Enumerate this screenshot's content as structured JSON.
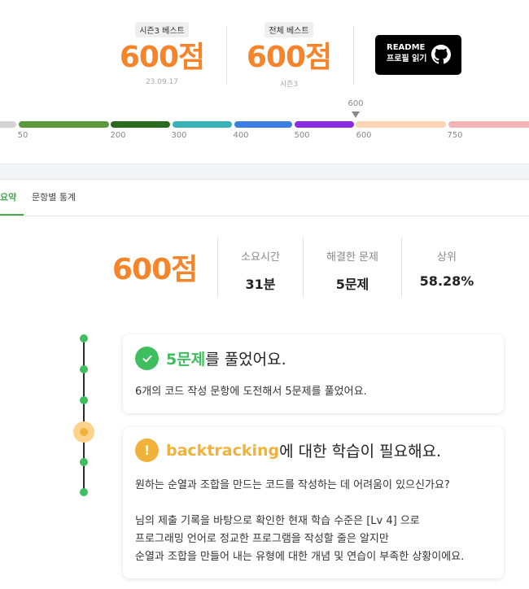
{
  "best_scores": {
    "season": {
      "tag": "시즌3 베스트",
      "score": "600점",
      "sub": "23.09.17"
    },
    "overall": {
      "tag": "전체 베스트",
      "score": "600점",
      "sub": "시즌3"
    }
  },
  "readme_button": {
    "line1": "README",
    "line2": "프로필 읽기",
    "icon": "github-icon"
  },
  "rating_bar": {
    "current_marker": "600",
    "ticks": [
      "50",
      "200",
      "300",
      "400",
      "500",
      "600",
      "750"
    ],
    "segment_colors": [
      "#d3d3d3",
      "#5a9a3c",
      "#2c6b1f",
      "#38b2b6",
      "#3d7fe0",
      "#8a2be2",
      "#f9d5b3",
      "#f6b3b5"
    ]
  },
  "tabs": {
    "summary": "요약",
    "stats": "문항별 통계"
  },
  "summary": {
    "score": "600점",
    "stats": [
      {
        "label": "소요시간",
        "value": "31분"
      },
      {
        "label": "해결한 문제",
        "value": "5문제"
      },
      {
        "label": "상위",
        "value": "58.28%"
      }
    ]
  },
  "cards": [
    {
      "icon": "check-icon",
      "highlight": "5문제",
      "title_rest": "를 풀었어요.",
      "body": [
        "6개의 코드 작성 문항에 도전해서 5문제를 풀었어요."
      ]
    },
    {
      "icon": "exclamation-icon",
      "highlight": "backtracking",
      "title_rest": "에 대한 학습이 필요해요.",
      "body": [
        "원하는 순열과 조합을 만드는 코드를 작성하는 데 어려움이 있으신가요?",
        "",
        "님의 제출 기록을 바탕으로 확인한 현재 학습 수준은 [Lv 4] 으로",
        "프로그래밍 언어로 정교한 프로그램을 작성할 줄은 알지만",
        "순열과 조합을 만들어 내는 유형에 대한 개념 및 연습이 부족한 상황이에요."
      ]
    }
  ],
  "colors": {
    "accent_orange": "#f5842b",
    "accent_green": "#3ebe5e",
    "warn_yellow": "#f0b23a"
  }
}
